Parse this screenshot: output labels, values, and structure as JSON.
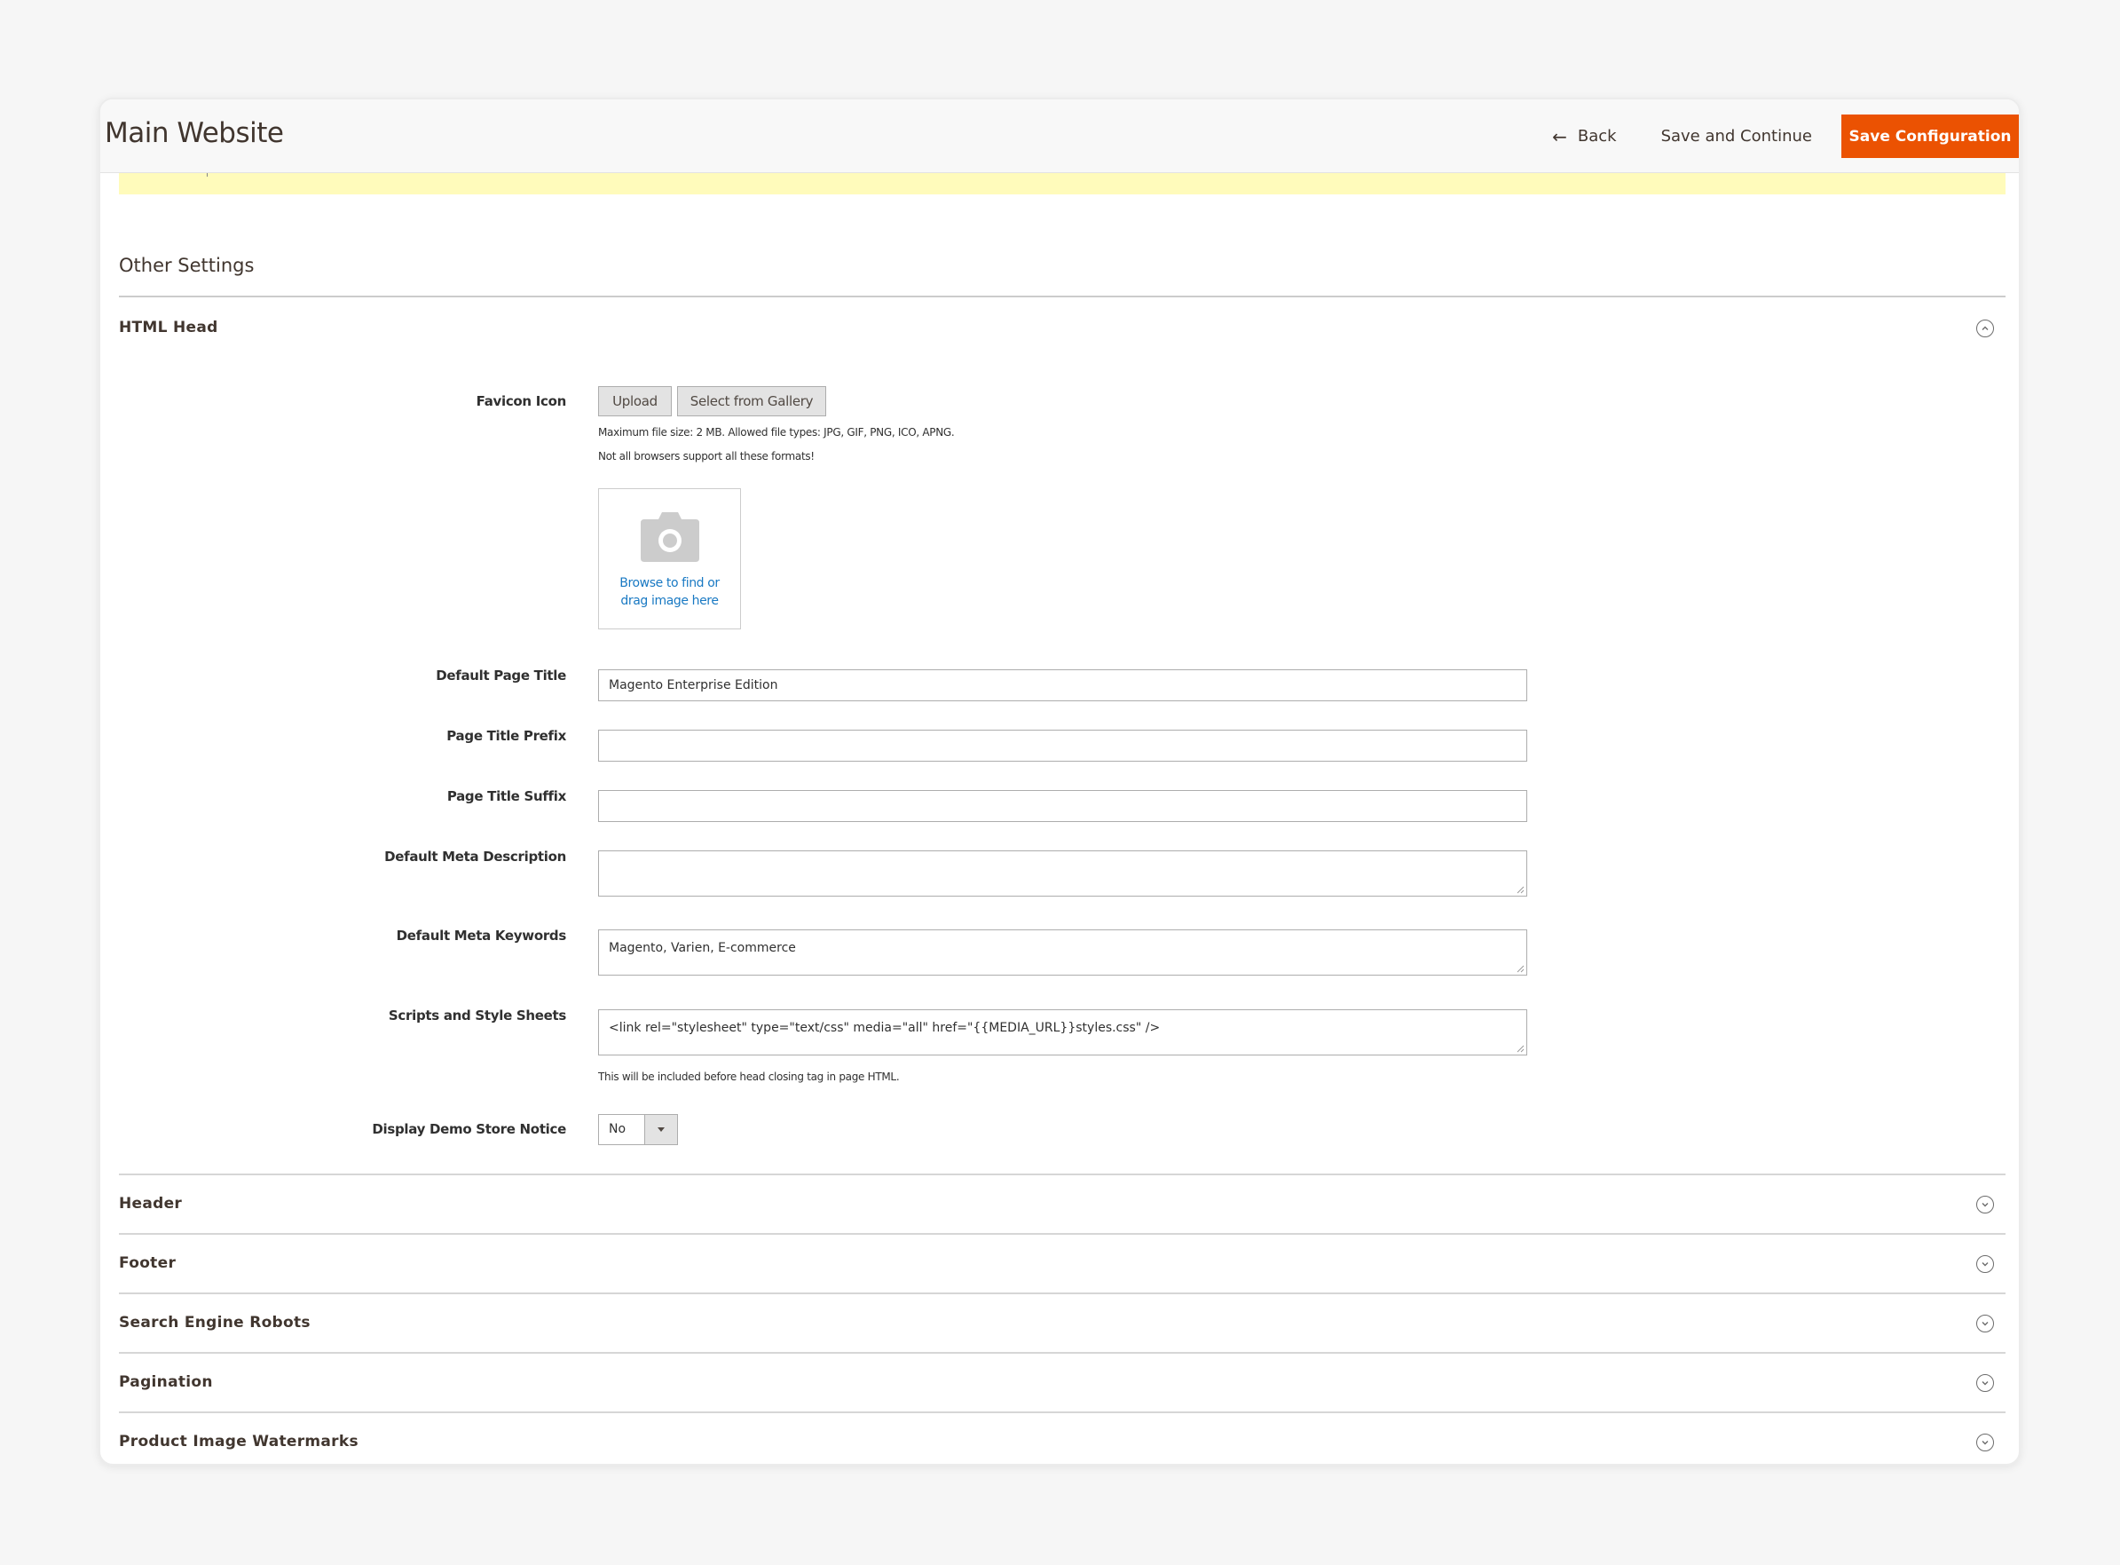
{
  "header": {
    "title": "Main Website",
    "back_label": "Back",
    "save_continue_label": "Save and Continue",
    "save_config_label": "Save Configuration",
    "accent_color": "#eb5202"
  },
  "section_title": "Other Settings",
  "html_head": {
    "title": "HTML Head",
    "expanded": true,
    "favicon": {
      "label": "Favicon Icon",
      "upload_label": "Upload",
      "gallery_label": "Select from Gallery",
      "note_size": "Maximum file size: 2 MB. Allowed file types: JPG, GIF, PNG, ICO, APNG.",
      "note_browsers": "Not all browsers support all these formats!",
      "drop_text": "Browse to find or drag image here"
    },
    "fields": {
      "default_page_title": {
        "label": "Default Page Title",
        "value": "Magento Enterprise Edition"
      },
      "page_title_prefix": {
        "label": "Page Title Prefix",
        "value": ""
      },
      "page_title_suffix": {
        "label": "Page Title Suffix",
        "value": ""
      },
      "default_meta_description": {
        "label": "Default Meta Description",
        "value": ""
      },
      "default_meta_keywords": {
        "label": "Default Meta Keywords",
        "value": "Magento, Varien, E-commerce"
      },
      "scripts_and_style_sheets": {
        "label": "Scripts and Style Sheets",
        "value": "<link  rel=\"stylesheet\" type=\"text/css\"  media=\"all\" href=\"{{MEDIA_URL}}styles.css\" />",
        "note": "This will be included before head closing tag in page HTML."
      },
      "display_demo_store_notice": {
        "label": "Display Demo Store Notice",
        "value": "No"
      }
    }
  },
  "collapsed_groups": [
    {
      "title": "Header"
    },
    {
      "title": "Footer"
    },
    {
      "title": "Search Engine Robots"
    },
    {
      "title": "Pagination"
    },
    {
      "title": "Product Image Watermarks"
    }
  ]
}
